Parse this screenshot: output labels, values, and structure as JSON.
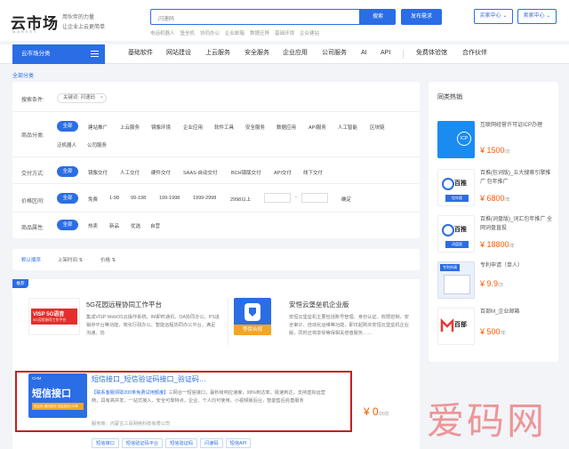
{
  "header": {
    "logo_text": "云市场",
    "logo_sub": "MARKET",
    "slogan_line1": "用伙伴的力量",
    "slogan_line2": "让企业上云更简单",
    "search_value": "闪速码",
    "search_button": "搜索",
    "publish_button": "发布需求",
    "buyer_center": "买家中心",
    "seller_center": "卖家中心",
    "hot_keywords": [
      "电话机器人",
      "堡垒机",
      "协同办公",
      "企业邮箱",
      "数据迁移",
      "基础环境",
      "企业建站"
    ]
  },
  "nav": {
    "category_button": "云市场分类",
    "items": [
      "基础软件",
      "网站建设",
      "上云服务",
      "安全服务",
      "企业应用",
      "公司服务",
      "AI",
      "API",
      "免费体验馆",
      "合作伙伴"
    ]
  },
  "breadcrumb": "全部分类",
  "filters": {
    "conditions_label": "搜索条件:",
    "keyword_tag": "关键词: 闪速码",
    "keyword_close": "×",
    "category_label": "商品分类:",
    "all_label": "全部",
    "category_options": [
      "建站推广",
      "上云服务",
      "镜像环境",
      "企业应用",
      "软件工具",
      "安全服务",
      "数据应用",
      "API服务",
      "人工智能",
      "区块链",
      "泛机器人",
      "公司服务"
    ],
    "delivery_label": "交付方式:",
    "delivery_options": [
      "镜像交付",
      "人工交付",
      "硬件交付",
      "SAAS-自动交付",
      "BCH镜版交付",
      "API交付",
      "线下交付"
    ],
    "price_label": "价格区间:",
    "price_options": [
      "免费",
      "1-98",
      "99-198",
      "199-1998",
      "1999-2998",
      "2998以上"
    ],
    "price_dash": "-",
    "price_confirm": "确定",
    "attr_label": "商品属性:",
    "attr_options": [
      "热卖",
      "新品",
      "优选",
      "自营"
    ]
  },
  "sort": {
    "default": "默认顺序",
    "time": "上架时间",
    "price": "价格",
    "time_arrow": "⇅",
    "price_arrow": "⇅"
  },
  "results": {
    "recommend_badge": "推荐",
    "card1": {
      "thumb_text": "VISP 5G语音",
      "thumb_sub": "5G远程协同工作平台",
      "title": "5G花园远程协同工作平台",
      "desc": "集成VISP WebOS云操作系统、IM即时通讯、OA协同办公、PS进销存平台等功能，简化行政办公、智能远程协同办公平台，满足沟通、协"
    },
    "card2": {
      "thumb_badge": "等保合规",
      "title": "安恒云堡垒机企业版",
      "desc": "安恒云堡垒机主要包括账号管理、身份认证、权限控制、安全审计、自动化运维等功能，即日起购买安恒云堡垒机企业版，同时还将享受等保相关增值服务……"
    },
    "sms": {
      "thumb_brand": "CHM",
      "thumb_text": "短信接口",
      "thumb_sub": "验证码·通知短信 批量推送100条",
      "title": "短信接口_短信验证码接口_验证码…",
      "desc_highlight": "【联系客服领取200条免费试用额度】",
      "desc": "三网合一短信接口，毫秒级响应速度，99%到达率，极速到达，支持虚拟运营商，具有高并发、一站式接入、安全可靠特点，企业、个人均可使用，小视频版后台，智能售后完善服务",
      "vendor": "服务商：内蒙古三百网络科技有限公司",
      "price": "¥ 0",
      "price_unit": "/20次",
      "tags": [
        "短信接口",
        "短信验证码平台",
        "短信验证码",
        "闪速码",
        "短信API"
      ]
    }
  },
  "sidebar": {
    "title": "同类热销",
    "items": [
      {
        "name": "互联网经营许可证ICP办理",
        "price": "¥ 1500",
        "unit": "/次",
        "thumb": "ICP"
      },
      {
        "name": "百推(包词版)_五大搜索引擎推广 包年推广",
        "price": "¥ 6800",
        "unit": "/年",
        "thumb": "百推",
        "thumb_sub": "包年版"
      },
      {
        "name": "百推(词盘版)_词汇包年推广 全网词盘直投",
        "price": "¥ 18800",
        "unit": "/年",
        "thumb": "百推",
        "thumb_sub": "词盘版"
      },
      {
        "name": "专利申请（单人）",
        "price": "¥ 9.9",
        "unit": "/次",
        "thumb": "专利申请"
      },
      {
        "name": "百部M_企业邮箱",
        "price": "¥ 500",
        "unit": "/年",
        "thumb": "百部"
      }
    ]
  },
  "watermark": "爱码网",
  "colors": {
    "accent": "#2b6de5",
    "price": "#ff5a00",
    "highlight_border": "#c81e1e"
  }
}
